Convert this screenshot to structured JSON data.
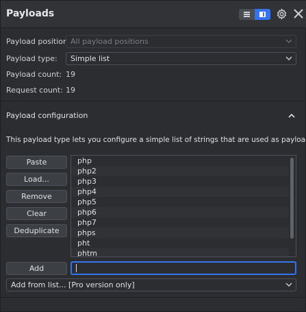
{
  "header": {
    "title": "Payloads",
    "accent_color": "#3574f0"
  },
  "payload_position": {
    "label": "Payload position:",
    "value": "All payload positions"
  },
  "payload_type": {
    "label": "Payload type:",
    "value": "Simple list"
  },
  "payload_count": {
    "label": "Payload count:",
    "value": "19"
  },
  "request_count": {
    "label": "Request count:",
    "value": "19"
  },
  "config": {
    "title": "Payload configuration",
    "description": "This payload type lets you configure a simple list of strings that are used as payloads.",
    "buttons": {
      "paste": "Paste",
      "load": "Load...",
      "remove": "Remove",
      "clear": "Clear",
      "deduplicate": "Deduplicate",
      "add": "Add"
    },
    "items": [
      "php",
      "php2",
      "php3",
      "php4",
      "php5",
      "php6",
      "php7",
      "phps",
      "pht",
      "phtm"
    ],
    "add_input_value": "",
    "add_from_list": "Add from list... [Pro version only]"
  }
}
